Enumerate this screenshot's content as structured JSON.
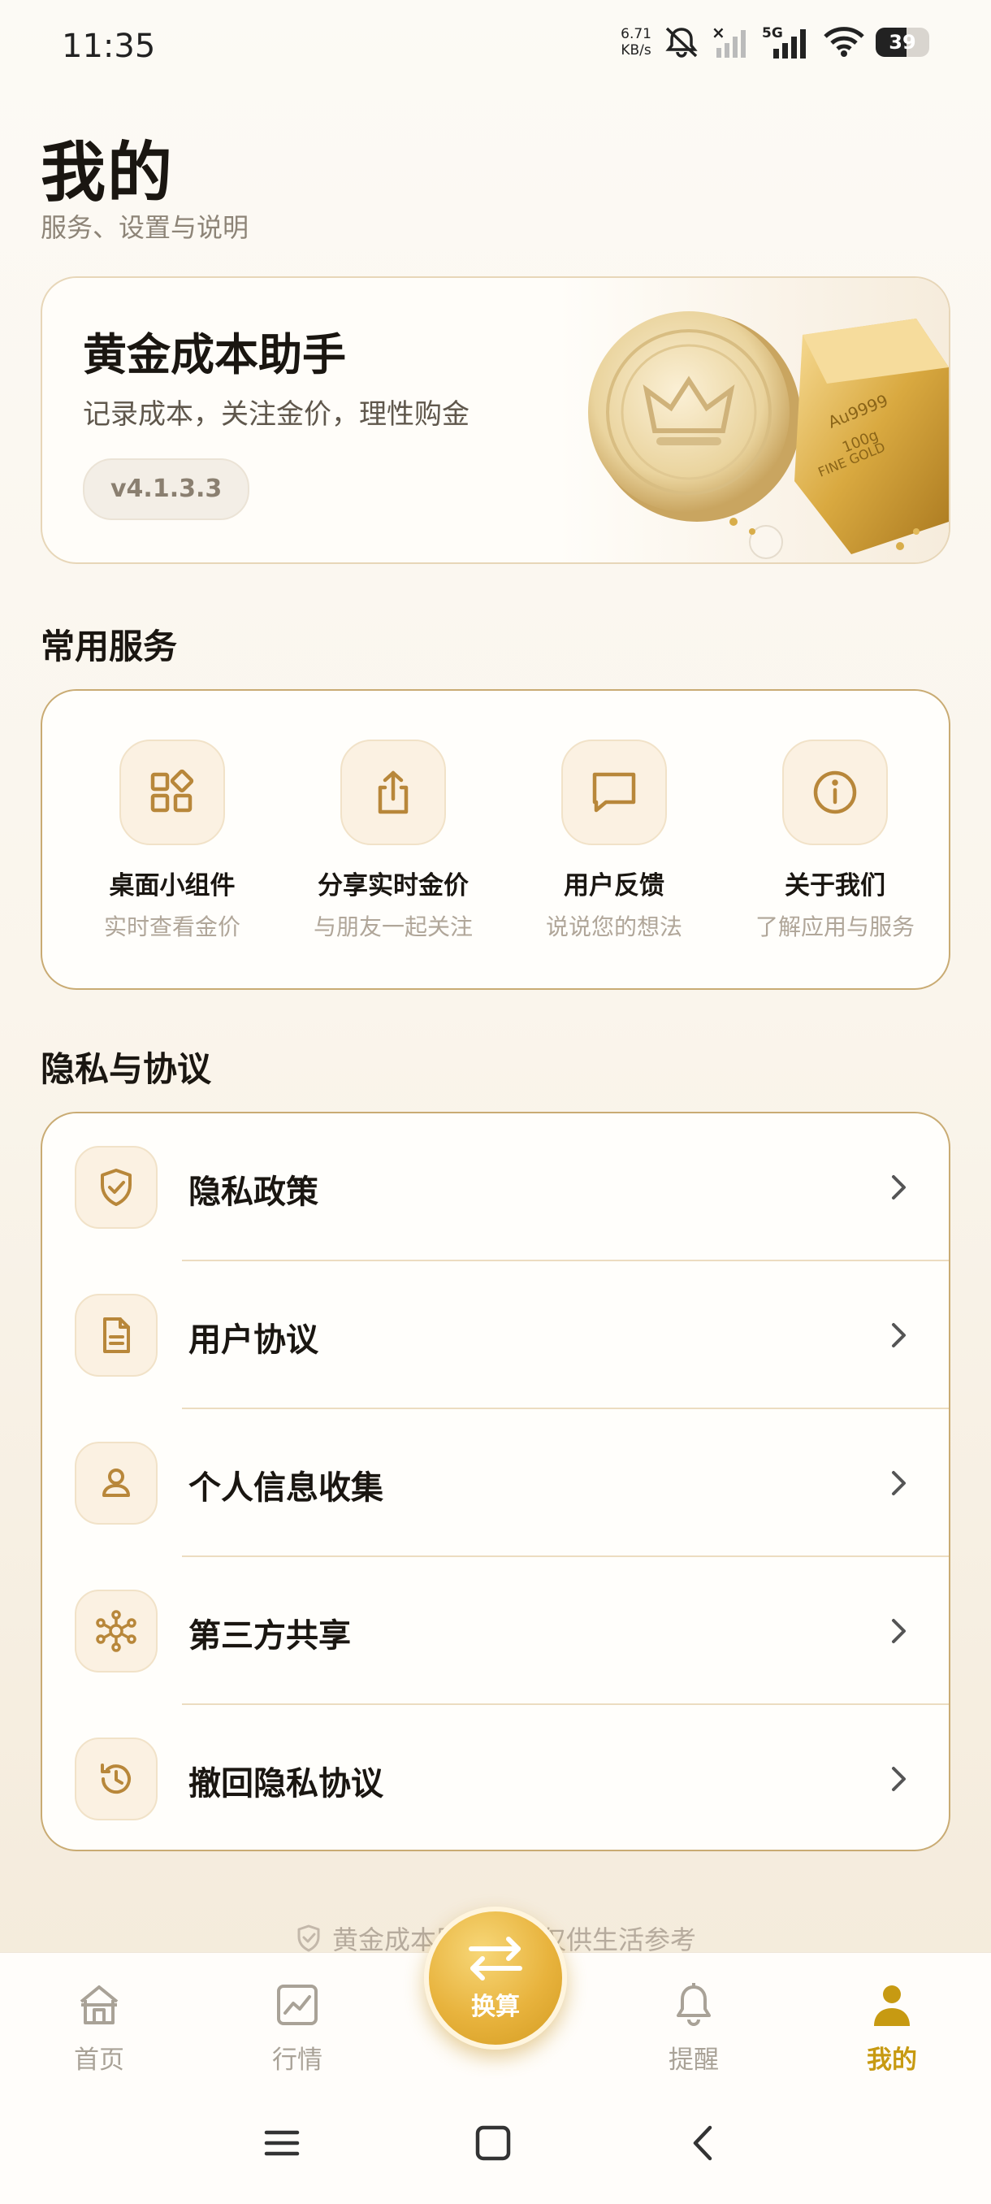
{
  "status_bar": {
    "time": "11:35",
    "net_speed": "6.71",
    "net_speed_unit": "KB/s",
    "network": "5G",
    "battery": "39"
  },
  "header": {
    "title": "我的",
    "subtitle": "服务、设置与说明"
  },
  "hero": {
    "title": "黄金成本助手",
    "description": "记录成本，关注金价，理性购金",
    "version": "v4.1.3.3"
  },
  "services": {
    "title": "常用服务",
    "items": [
      {
        "name": "桌面小组件",
        "sub": "实时查看金价",
        "icon": "widgets-icon"
      },
      {
        "name": "分享实时金价",
        "sub": "与朋友一起关注",
        "icon": "share-icon"
      },
      {
        "name": "用户反馈",
        "sub": "说说您的想法",
        "icon": "message-icon"
      },
      {
        "name": "关于我们",
        "sub": "了解应用与服务",
        "icon": "info-icon"
      }
    ]
  },
  "privacy": {
    "title": "隐私与协议",
    "items": [
      {
        "label": "隐私政策",
        "icon": "shield-check-icon"
      },
      {
        "label": "用户协议",
        "icon": "document-icon"
      },
      {
        "label": "个人信息收集",
        "icon": "person-icon"
      },
      {
        "label": "第三方共享",
        "icon": "share-network-icon"
      },
      {
        "label": "撤回隐私协议",
        "icon": "history-icon"
      }
    ]
  },
  "footer_note": "黄金成本助手数据仅供生活参考",
  "tabbar": {
    "items": [
      {
        "label": "首页",
        "icon": "home-icon"
      },
      {
        "label": "行情",
        "icon": "chart-icon"
      },
      {
        "label": "提醒",
        "icon": "bell-icon"
      },
      {
        "label": "我的",
        "icon": "profile-icon",
        "active": true
      }
    ],
    "center": {
      "label": "换算",
      "icon": "swap-icon"
    }
  },
  "colors": {
    "accent": "#c79a12",
    "border_gold": "#c9ab73",
    "icon_brown": "#b8873a"
  }
}
